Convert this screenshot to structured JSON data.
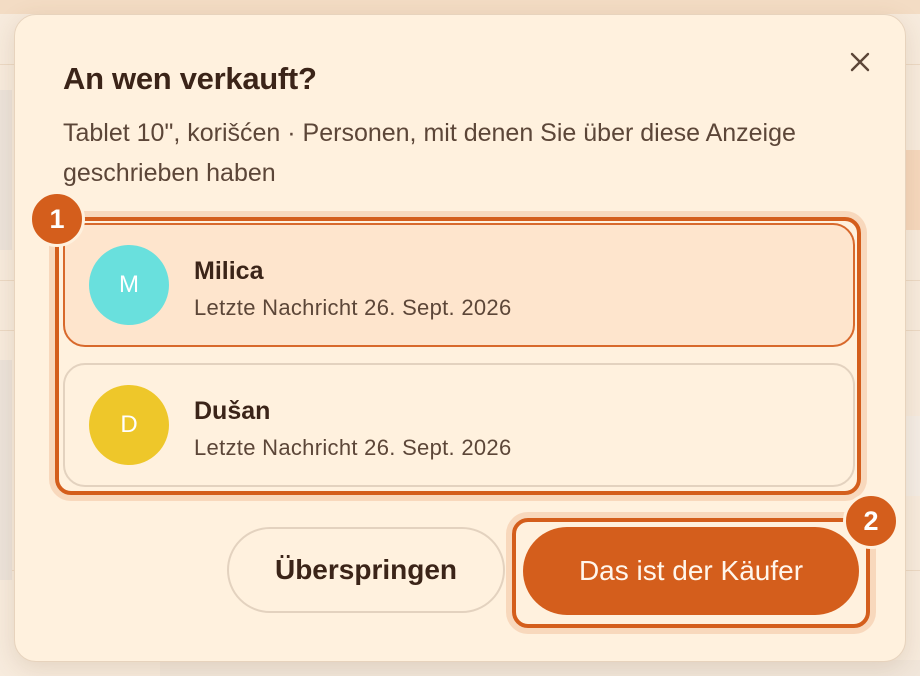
{
  "dialog": {
    "title": "An wen verkauft?",
    "subtitle": "Tablet 10\", korišćen · Personen, mit denen Sie über diese Anzeige geschrieben haben",
    "close_icon": "close-icon"
  },
  "buyers": [
    {
      "initial": "M",
      "name": "Milica",
      "last_message": "Letzte Nachricht 26. Sept. 2026",
      "avatar_color": "#69e0dd",
      "selected": true
    },
    {
      "initial": "D",
      "name": "Dušan",
      "last_message": "Letzte Nachricht 26. Sept. 2026",
      "avatar_color": "#eec72a",
      "selected": false
    }
  ],
  "actions": {
    "skip_label": "Überspringen",
    "confirm_label": "Das ist der Käufer"
  },
  "annotations": {
    "badge_1": "1",
    "badge_2": "2"
  },
  "colors": {
    "accent": "#d45e1c",
    "modal_bg": "#fff1de",
    "selected_bg": "#fee5cd"
  }
}
